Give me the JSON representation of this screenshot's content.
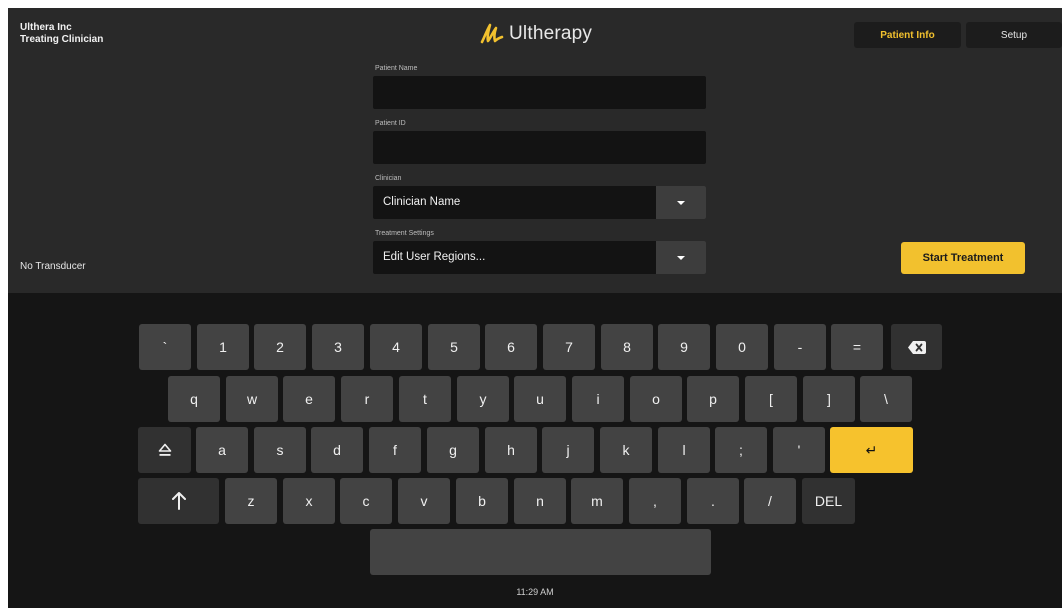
{
  "header": {
    "org_line1": "Ulthera Inc",
    "org_line2": "Treating Clinician",
    "brand_name": "Ultherapy",
    "tabs": [
      {
        "label": "Patient Info",
        "active": true
      },
      {
        "label": "Setup",
        "active": false
      }
    ]
  },
  "form": {
    "patient_name_label": "Patient Name",
    "patient_name_value": "",
    "patient_id_label": "Patient ID",
    "patient_id_value": "",
    "clinician_label": "Clinician",
    "clinician_value": "Clinician Name",
    "treatment_settings_label": "Treatment Settings",
    "treatment_settings_value": "Edit User Regions..."
  },
  "status": {
    "transducer": "No Transducer"
  },
  "actions": {
    "start_treatment": "Start Treatment"
  },
  "keyboard": {
    "row1": [
      "`",
      "1",
      "2",
      "3",
      "4",
      "5",
      "6",
      "7",
      "8",
      "9",
      "0",
      "-",
      "="
    ],
    "row2": [
      "q",
      "w",
      "e",
      "r",
      "t",
      "y",
      "u",
      "i",
      "o",
      "p",
      "[",
      "]",
      "\\"
    ],
    "row3": [
      "a",
      "s",
      "d",
      "f",
      "g",
      "h",
      "j",
      "k",
      "l",
      ";",
      "'"
    ],
    "row4": [
      "z",
      "x",
      "c",
      "v",
      "b",
      "n",
      "m",
      ",",
      ".",
      "/"
    ],
    "del_label": "DEL",
    "enter_glyph": "↵"
  },
  "clock": "11:29 AM",
  "colors": {
    "accent": "#f2c12e",
    "background": "#151515",
    "panel": "#292929",
    "key": "#434343"
  }
}
